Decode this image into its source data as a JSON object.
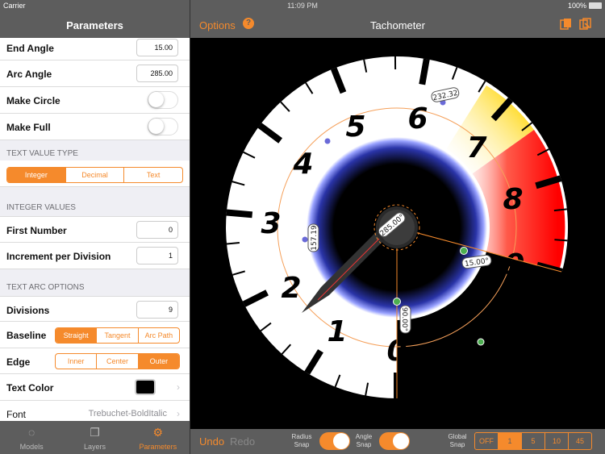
{
  "status": {
    "carrier": "Carrier",
    "time": "11:09 PM",
    "battery": "100%"
  },
  "left": {
    "title": "Parameters",
    "end_angle": {
      "label": "End Angle",
      "value": "15.00"
    },
    "arc_angle": {
      "label": "Arc Angle",
      "value": "285.00"
    },
    "make_circle": {
      "label": "Make Circle",
      "on": false
    },
    "make_full": {
      "label": "Make Full",
      "on": false
    },
    "text_value_type": {
      "section": "TEXT VALUE TYPE",
      "options": [
        "Integer",
        "Decimal",
        "Text"
      ],
      "selected": "Integer"
    },
    "integer_values": {
      "section": "INTEGER VALUES"
    },
    "first_number": {
      "label": "First Number",
      "value": "0"
    },
    "increment": {
      "label": "Increment per Division",
      "value": "1"
    },
    "text_arc": {
      "section": "TEXT ARC OPTIONS"
    },
    "divisions": {
      "label": "Divisions",
      "value": "9"
    },
    "baseline": {
      "label": "Baseline",
      "options": [
        "Straight",
        "Tangent",
        "Arc Path"
      ],
      "selected": "Straight"
    },
    "edge": {
      "label": "Edge",
      "options": [
        "Inner",
        "Center",
        "Outer"
      ],
      "selected": "Outer"
    },
    "text_color": {
      "label": "Text Color",
      "color": "#000000"
    },
    "font": {
      "label": "Font",
      "value": "Trebuchet-BoldItalic"
    }
  },
  "tabs": [
    {
      "label": "Models",
      "icon": "models-icon"
    },
    {
      "label": "Layers",
      "icon": "layers-icon"
    },
    {
      "label": "Parameters",
      "icon": "gear-icon"
    }
  ],
  "header": {
    "options_label": "Options",
    "help": "?",
    "title": "Tachometer"
  },
  "bottom": {
    "undo": "Undo",
    "redo": "Redo",
    "radius_snap": "Radius\nSnap",
    "angle_snap": "Angle\nSnap",
    "global_snap": "Global\nSnap",
    "snap_options": [
      "OFF",
      "1",
      "5",
      "10",
      "45"
    ],
    "snap_selected": "1"
  },
  "gauge": {
    "numbers": [
      "0",
      "1",
      "2",
      "3",
      "4",
      "5",
      "6",
      "7",
      "8",
      "9"
    ],
    "badges": [
      "232.32",
      "285.00°",
      "157.19",
      "15.00°",
      "90.00°"
    ]
  },
  "colors": {
    "accent": "#f58a2c",
    "bar": "#5d5d5d"
  }
}
